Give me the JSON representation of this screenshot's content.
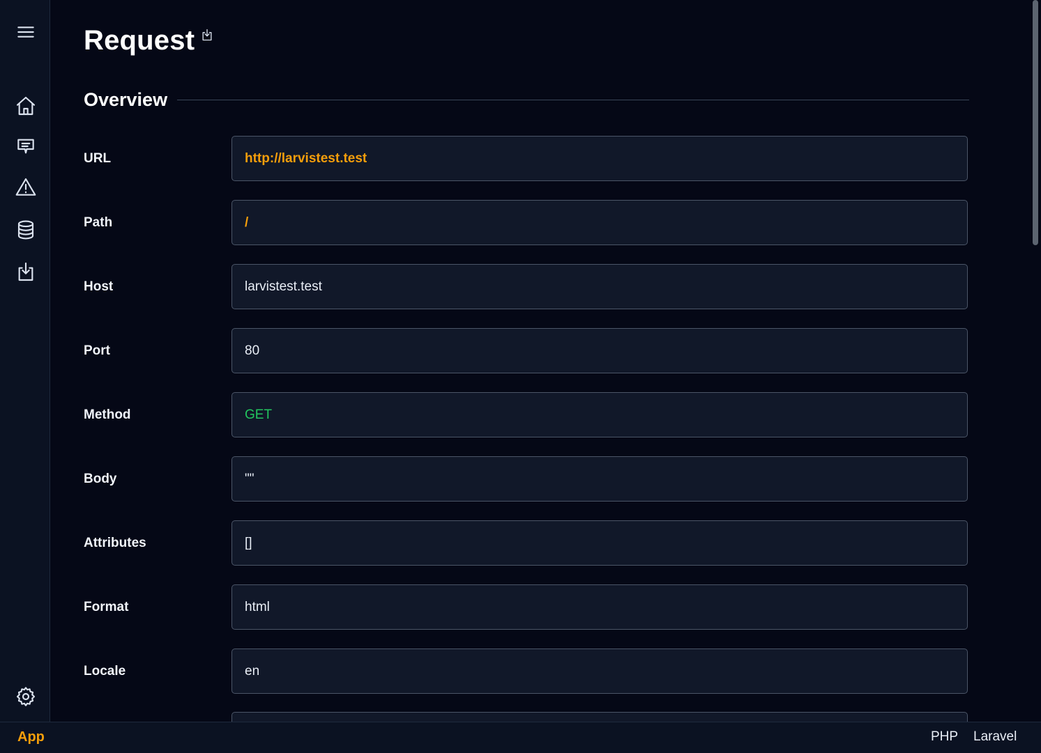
{
  "page": {
    "title": "Request"
  },
  "section": {
    "title": "Overview"
  },
  "fields": [
    {
      "label": "URL",
      "value": "http://larvistest.test"
    },
    {
      "label": "Path",
      "value": "/"
    },
    {
      "label": "Host",
      "value": "larvistest.test"
    },
    {
      "label": "Port",
      "value": "80"
    },
    {
      "label": "Method",
      "value": "GET"
    },
    {
      "label": "Body",
      "value": "\"\""
    },
    {
      "label": "Attributes",
      "value": "[]"
    },
    {
      "label": "Format",
      "value": "html"
    },
    {
      "label": "Locale",
      "value": "en"
    }
  ],
  "sidebar": {
    "items": [
      {
        "icon": "menu-icon"
      },
      {
        "icon": "home-icon"
      },
      {
        "icon": "message-icon"
      },
      {
        "icon": "warning-icon"
      },
      {
        "icon": "database-icon"
      },
      {
        "icon": "download-icon"
      },
      {
        "icon": "gear-icon"
      }
    ]
  },
  "footer": {
    "app": "App",
    "php": "PHP",
    "laravel": "Laravel"
  },
  "colors": {
    "accent": "#f59e0b",
    "method": "#22c55e",
    "background": "#050816",
    "panel": "#0b1222"
  }
}
